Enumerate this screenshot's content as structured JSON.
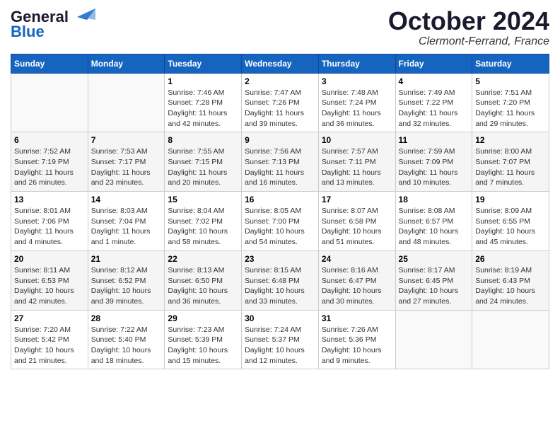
{
  "header": {
    "logo_line1": "General",
    "logo_line2": "Blue",
    "month": "October 2024",
    "location": "Clermont-Ferrand, France"
  },
  "weekdays": [
    "Sunday",
    "Monday",
    "Tuesday",
    "Wednesday",
    "Thursday",
    "Friday",
    "Saturday"
  ],
  "weeks": [
    [
      {
        "day": "",
        "info": ""
      },
      {
        "day": "",
        "info": ""
      },
      {
        "day": "1",
        "info": "Sunrise: 7:46 AM\nSunset: 7:28 PM\nDaylight: 11 hours and 42 minutes."
      },
      {
        "day": "2",
        "info": "Sunrise: 7:47 AM\nSunset: 7:26 PM\nDaylight: 11 hours and 39 minutes."
      },
      {
        "day": "3",
        "info": "Sunrise: 7:48 AM\nSunset: 7:24 PM\nDaylight: 11 hours and 36 minutes."
      },
      {
        "day": "4",
        "info": "Sunrise: 7:49 AM\nSunset: 7:22 PM\nDaylight: 11 hours and 32 minutes."
      },
      {
        "day": "5",
        "info": "Sunrise: 7:51 AM\nSunset: 7:20 PM\nDaylight: 11 hours and 29 minutes."
      }
    ],
    [
      {
        "day": "6",
        "info": "Sunrise: 7:52 AM\nSunset: 7:19 PM\nDaylight: 11 hours and 26 minutes."
      },
      {
        "day": "7",
        "info": "Sunrise: 7:53 AM\nSunset: 7:17 PM\nDaylight: 11 hours and 23 minutes."
      },
      {
        "day": "8",
        "info": "Sunrise: 7:55 AM\nSunset: 7:15 PM\nDaylight: 11 hours and 20 minutes."
      },
      {
        "day": "9",
        "info": "Sunrise: 7:56 AM\nSunset: 7:13 PM\nDaylight: 11 hours and 16 minutes."
      },
      {
        "day": "10",
        "info": "Sunrise: 7:57 AM\nSunset: 7:11 PM\nDaylight: 11 hours and 13 minutes."
      },
      {
        "day": "11",
        "info": "Sunrise: 7:59 AM\nSunset: 7:09 PM\nDaylight: 11 hours and 10 minutes."
      },
      {
        "day": "12",
        "info": "Sunrise: 8:00 AM\nSunset: 7:07 PM\nDaylight: 11 hours and 7 minutes."
      }
    ],
    [
      {
        "day": "13",
        "info": "Sunrise: 8:01 AM\nSunset: 7:06 PM\nDaylight: 11 hours and 4 minutes."
      },
      {
        "day": "14",
        "info": "Sunrise: 8:03 AM\nSunset: 7:04 PM\nDaylight: 11 hours and 1 minute."
      },
      {
        "day": "15",
        "info": "Sunrise: 8:04 AM\nSunset: 7:02 PM\nDaylight: 10 hours and 58 minutes."
      },
      {
        "day": "16",
        "info": "Sunrise: 8:05 AM\nSunset: 7:00 PM\nDaylight: 10 hours and 54 minutes."
      },
      {
        "day": "17",
        "info": "Sunrise: 8:07 AM\nSunset: 6:58 PM\nDaylight: 10 hours and 51 minutes."
      },
      {
        "day": "18",
        "info": "Sunrise: 8:08 AM\nSunset: 6:57 PM\nDaylight: 10 hours and 48 minutes."
      },
      {
        "day": "19",
        "info": "Sunrise: 8:09 AM\nSunset: 6:55 PM\nDaylight: 10 hours and 45 minutes."
      }
    ],
    [
      {
        "day": "20",
        "info": "Sunrise: 8:11 AM\nSunset: 6:53 PM\nDaylight: 10 hours and 42 minutes."
      },
      {
        "day": "21",
        "info": "Sunrise: 8:12 AM\nSunset: 6:52 PM\nDaylight: 10 hours and 39 minutes."
      },
      {
        "day": "22",
        "info": "Sunrise: 8:13 AM\nSunset: 6:50 PM\nDaylight: 10 hours and 36 minutes."
      },
      {
        "day": "23",
        "info": "Sunrise: 8:15 AM\nSunset: 6:48 PM\nDaylight: 10 hours and 33 minutes."
      },
      {
        "day": "24",
        "info": "Sunrise: 8:16 AM\nSunset: 6:47 PM\nDaylight: 10 hours and 30 minutes."
      },
      {
        "day": "25",
        "info": "Sunrise: 8:17 AM\nSunset: 6:45 PM\nDaylight: 10 hours and 27 minutes."
      },
      {
        "day": "26",
        "info": "Sunrise: 8:19 AM\nSunset: 6:43 PM\nDaylight: 10 hours and 24 minutes."
      }
    ],
    [
      {
        "day": "27",
        "info": "Sunrise: 7:20 AM\nSunset: 5:42 PM\nDaylight: 10 hours and 21 minutes."
      },
      {
        "day": "28",
        "info": "Sunrise: 7:22 AM\nSunset: 5:40 PM\nDaylight: 10 hours and 18 minutes."
      },
      {
        "day": "29",
        "info": "Sunrise: 7:23 AM\nSunset: 5:39 PM\nDaylight: 10 hours and 15 minutes."
      },
      {
        "day": "30",
        "info": "Sunrise: 7:24 AM\nSunset: 5:37 PM\nDaylight: 10 hours and 12 minutes."
      },
      {
        "day": "31",
        "info": "Sunrise: 7:26 AM\nSunset: 5:36 PM\nDaylight: 10 hours and 9 minutes."
      },
      {
        "day": "",
        "info": ""
      },
      {
        "day": "",
        "info": ""
      }
    ]
  ]
}
